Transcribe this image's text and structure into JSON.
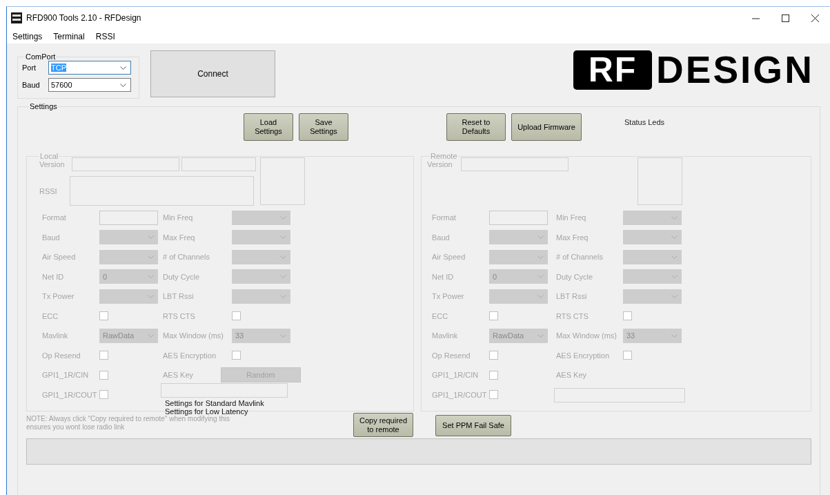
{
  "window": {
    "title": "RFD900 Tools 2.10 - RFDesign"
  },
  "menu": [
    "Settings",
    "Terminal",
    "RSSI"
  ],
  "comport": {
    "title": "ComPort",
    "fields": [
      {
        "label": "Port",
        "value": "TCP",
        "focused": true
      },
      {
        "label": "Baud",
        "value": "57600",
        "focused": false
      }
    ]
  },
  "connect_button": "Connect",
  "logo": {
    "badge": "RF",
    "word": "DESIGN"
  },
  "settings": {
    "title": "Settings",
    "file_buttons": [
      "Load Settings",
      "Save Settings"
    ],
    "tool_buttons": [
      "Reset to Defaults",
      "Upload Firmware"
    ],
    "status_leds": "Status Leds",
    "panels": [
      {
        "title": "Local",
        "kind": "local",
        "disabled": true,
        "version_label": "Version",
        "rssi_label": "RSSI",
        "left": [
          {
            "label": "Format",
            "kind": "text"
          },
          {
            "label": "Baud",
            "kind": "combo"
          },
          {
            "label": "Air Speed",
            "kind": "combo"
          },
          {
            "label": "Net ID",
            "kind": "combo",
            "value": "0"
          },
          {
            "label": "Tx Power",
            "kind": "combo"
          },
          {
            "label": "ECC",
            "kind": "check",
            "checked": false
          },
          {
            "label": "Mavlink",
            "kind": "combo",
            "value": "RawData"
          },
          {
            "label": "Op Resend",
            "kind": "check",
            "checked": false
          },
          {
            "label": "GPI1_1R/CIN",
            "kind": "check",
            "checked": false
          },
          {
            "label": "GPI1_1R/COUT",
            "kind": "check",
            "checked": false
          }
        ],
        "right": [
          {
            "label": "Min Freq",
            "kind": "combo"
          },
          {
            "label": "Max Freq",
            "kind": "combo"
          },
          {
            "label": "# of Channels",
            "kind": "combo"
          },
          {
            "label": "Duty Cycle",
            "kind": "combo"
          },
          {
            "label": "LBT Rssi",
            "kind": "combo"
          },
          {
            "label": "RTS CTS",
            "kind": "check",
            "checked": false
          },
          {
            "label": "Max Window (ms)",
            "kind": "combo",
            "value": "33"
          },
          {
            "label": "AES Encryption",
            "kind": "check",
            "checked": false
          },
          {
            "label": "AES Key",
            "kind": "key",
            "button": {
              "label": "Random",
              "disabled": true
            }
          }
        ],
        "presets": [
          "Settings for Standard Mavlink",
          "Settings for Low Latency"
        ]
      },
      {
        "title": "Remote",
        "kind": "remote",
        "disabled": true,
        "version_label": "Version",
        "left": [
          {
            "label": "Format",
            "kind": "text"
          },
          {
            "label": "Baud",
            "kind": "combo"
          },
          {
            "label": "Air Speed",
            "kind": "combo"
          },
          {
            "label": "Net ID",
            "kind": "combo",
            "value": "0"
          },
          {
            "label": "Tx Power",
            "kind": "combo"
          },
          {
            "label": "ECC",
            "kind": "check",
            "checked": false
          },
          {
            "label": "Mavlink",
            "kind": "combo",
            "value": "RawData"
          },
          {
            "label": "Op Resend",
            "kind": "check",
            "checked": false
          },
          {
            "label": "GPI1_1R/CIN",
            "kind": "check",
            "checked": false
          },
          {
            "label": "GPI1_1R/COUT",
            "kind": "check",
            "checked": false
          }
        ],
        "right": [
          {
            "label": "Min Freq",
            "kind": "combo"
          },
          {
            "label": "Max Freq",
            "kind": "combo"
          },
          {
            "label": "# of Channels",
            "kind": "combo"
          },
          {
            "label": "Duty Cycle",
            "kind": "combo"
          },
          {
            "label": "LBT Rssi",
            "kind": "combo"
          },
          {
            "label": "RTS CTS",
            "kind": "check",
            "checked": false
          },
          {
            "label": "Max Window (ms)",
            "kind": "combo",
            "value": "33"
          },
          {
            "label": "AES Encryption",
            "kind": "check",
            "checked": false
          },
          {
            "label": "AES Key",
            "kind": "key"
          }
        ]
      }
    ],
    "note": "NOTE: Always click \"Copy required to remote\" when modifying this ensures you wont lose radio link",
    "copy_button": "Copy required to remote",
    "ppm_button": "Set PPM Fail Safe"
  }
}
